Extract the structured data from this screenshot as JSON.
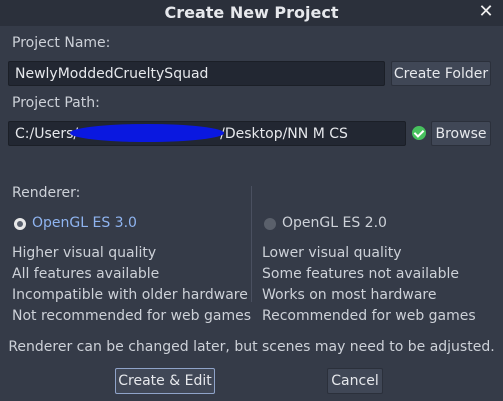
{
  "dialog": {
    "title": "Create New Project",
    "close_glyph": "✕"
  },
  "project_name": {
    "label": "Project Name:",
    "value": "NewlyModdedCrueltySquad",
    "create_folder_label": "Create Folder"
  },
  "project_path": {
    "label": "Project Path:",
    "value_prefix": "C:/Users/",
    "value_suffix": "/Desktop/NN M CS",
    "status": "valid",
    "browse_label": "Browse"
  },
  "renderer": {
    "label": "Renderer:",
    "selected": "OpenGL ES 3.0",
    "options": [
      {
        "name": "OpenGL ES 3.0",
        "features": [
          "Higher visual quality",
          "All features available",
          "Incompatible with older hardware",
          "Not recommended for web games"
        ]
      },
      {
        "name": "OpenGL ES 2.0",
        "features": [
          "Lower visual quality",
          "Some features not available",
          "Works on most hardware",
          "Recommended for web games"
        ]
      }
    ],
    "note": "Renderer can be changed later, but scenes may need to be adjusted."
  },
  "actions": {
    "create_edit_label": "Create & Edit",
    "cancel_label": "Cancel"
  },
  "colors": {
    "accent": "#8fb4f0",
    "valid": "#47c15e",
    "redaction": "#0a18e0"
  }
}
